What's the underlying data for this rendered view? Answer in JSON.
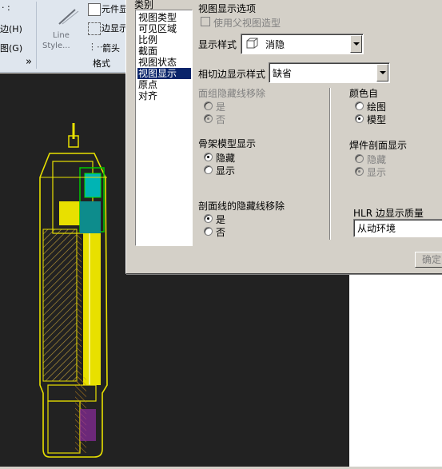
{
  "ribbon": {
    "left_top": "· :",
    "edge_item": "边(H)",
    "view_item": "图(G)",
    "line_style_1": "Line",
    "line_style_2": "Style...",
    "component_btn": "元件显",
    "edge_display": "边显示",
    "arrow": "箭头",
    "format_group": "格式",
    "collapse_glyph": "»",
    "colors": {
      "ribbon_bg": "#dfe6ee"
    }
  },
  "dialog": {
    "category_label": "类别",
    "categories": [
      "视图类型",
      "可见区域",
      "比例",
      "截面",
      "视图状态",
      "视图显示",
      "原点",
      "对齐"
    ],
    "selected_category": "视图显示",
    "section_title": "视图显示选项",
    "use_parent_style": "使用父视图造型",
    "display_style_label": "显示样式",
    "display_style_value": "消隐",
    "tangent_label": "相切边显示样式",
    "tangent_value": "缺省",
    "face_group_label": "面组隐藏线移除",
    "face_group_yes": "是",
    "face_group_no": "否",
    "color_from_label": "颜色自",
    "color_drawing": "绘图",
    "color_model": "模型",
    "skeleton_label": "骨架模型显示",
    "skeleton_hide": "隐藏",
    "skeleton_show": "显示",
    "weld_label": "焊件剖面显示",
    "weld_hide": "隐藏",
    "weld_show": "显示",
    "section_hidden_label": "剖面线的隐藏线移除",
    "section_yes": "是",
    "section_no": "否",
    "hlr_label": "HLR 边显示质量",
    "hlr_value": "从动环境",
    "ok_button": "确定",
    "colors": {
      "selection": "#0a246a",
      "face": "#d4d0c8"
    }
  }
}
